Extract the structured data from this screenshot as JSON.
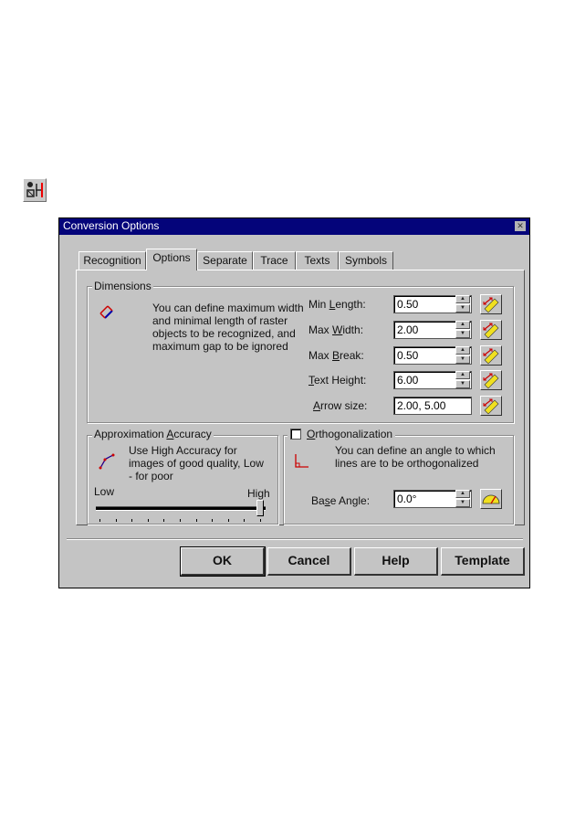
{
  "toolbar_icon": "conversion-options-icon",
  "dialog": {
    "title": "Conversion Options",
    "close_icon": "close-icon",
    "tabs": [
      {
        "label": "Recognition",
        "active": false
      },
      {
        "label": "Options",
        "active": true
      },
      {
        "label": "Separate",
        "active": false
      },
      {
        "label": "Trace",
        "active": false
      },
      {
        "label": "Texts",
        "active": false
      },
      {
        "label": "Symbols",
        "active": false
      }
    ],
    "dimensions": {
      "legend": "Dimensions",
      "description": "You can define maximum width and minimal length of raster objects to be recognized, and maximum gap to be ignored",
      "fields": [
        {
          "label_pre": "Min ",
          "label_u": "L",
          "label_post": "ength:",
          "value": "0.50",
          "spinner": true
        },
        {
          "label_pre": "Max ",
          "label_u": "W",
          "label_post": "idth:",
          "value": "2.00",
          "spinner": true
        },
        {
          "label_pre": "Max ",
          "label_u": "B",
          "label_post": "reak:",
          "value": "0.50",
          "spinner": true
        },
        {
          "label_pre": "",
          "label_u": "T",
          "label_post": "ext Height:",
          "value": "6.00",
          "spinner": true
        },
        {
          "label_pre": "",
          "label_u": "A",
          "label_post": "rrow size:",
          "value": "2.00, 5.00",
          "spinner": false
        }
      ]
    },
    "approximation": {
      "legend_pre": "Approximation ",
      "legend_u": "A",
      "legend_post": "ccuracy",
      "description": "Use High Accuracy  for images of good quality, Low - for poor",
      "low_label": "Low",
      "high_label": "High",
      "slider_value": 1.0,
      "ticks": 11
    },
    "orthogonalization": {
      "checkbox_label_u": "O",
      "checkbox_label_post": "rthogonalization",
      "checked": false,
      "description": "You can define an angle to which lines are to be orthogonalized",
      "base_angle_label_pre": "Ba",
      "base_angle_label_u": "s",
      "base_angle_label_post": "e Angle:",
      "base_angle_value": "0.0°"
    },
    "buttons": {
      "ok": "OK",
      "cancel": "Cancel",
      "help": "Help",
      "template": "Template"
    }
  }
}
